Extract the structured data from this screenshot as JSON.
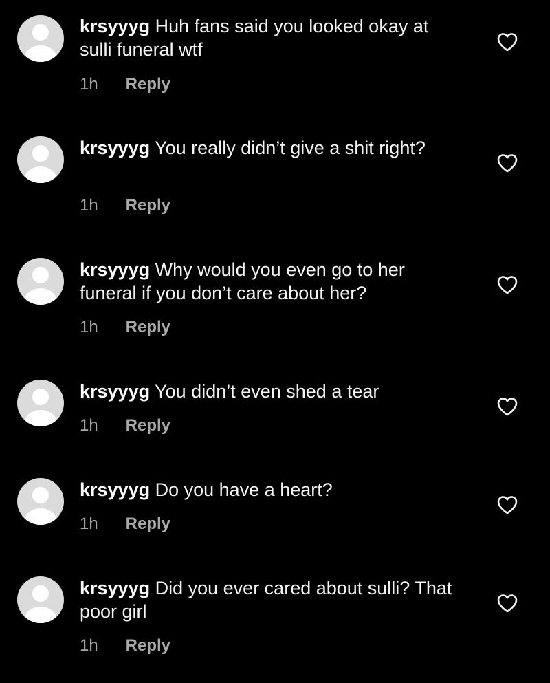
{
  "comments": [
    {
      "username": "krsyyyg",
      "text": "Huh fans said you looked okay at sulli funeral wtf",
      "time": "1h",
      "reply_label": "Reply"
    },
    {
      "username": "krsyyyg",
      "text": "You really didn’t give a shit right?",
      "time": "1h",
      "reply_label": "Reply"
    },
    {
      "username": "krsyyyg",
      "text": "Why would you even go to her funeral if you don’t care about her?",
      "time": "1h",
      "reply_label": "Reply"
    },
    {
      "username": "krsyyyg",
      "text": "You didn’t even shed a tear",
      "time": "1h",
      "reply_label": "Reply"
    },
    {
      "username": "krsyyyg",
      "text": "Do you have a heart?",
      "time": "1h",
      "reply_label": "Reply"
    },
    {
      "username": "krsyyyg",
      "text": "Did you ever cared about sulli? That poor girl",
      "time": "1h",
      "reply_label": "Reply"
    }
  ],
  "icons": {
    "avatar": "default-avatar-icon",
    "like": "heart-outline-icon"
  },
  "colors": {
    "background": "#000000",
    "text": "#f5f5f5",
    "secondary_text": "#a8a8a8",
    "avatar_bg": "#dbdbdb"
  }
}
